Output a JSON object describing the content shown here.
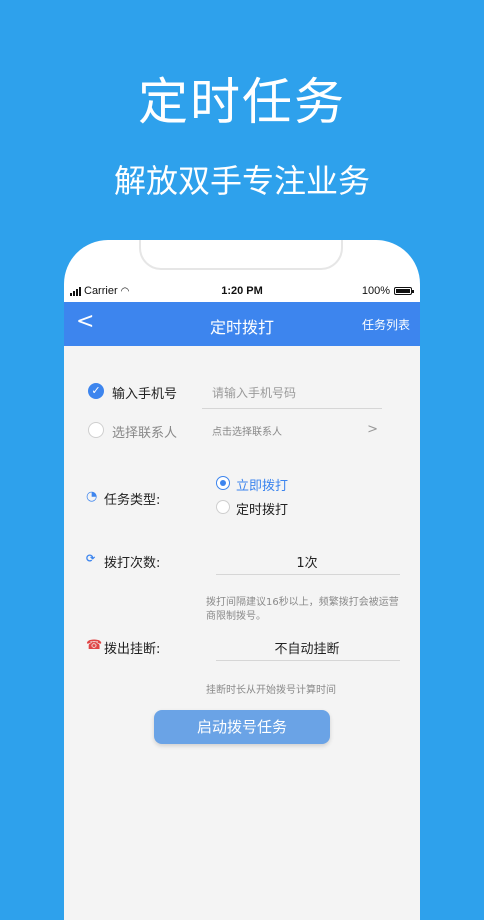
{
  "hero": {
    "title": "定时任务",
    "subtitle": "解放双手专注业务"
  },
  "status_bar": {
    "carrier": "Carrier",
    "time": "1:20 PM",
    "battery": "100%"
  },
  "nav": {
    "back": "<",
    "title": "定时拨打",
    "right": "任务列表"
  },
  "form": {
    "phone_option_label": "输入手机号",
    "phone_placeholder": "请输入手机号码",
    "contact_option_label": "选择联系人",
    "contact_placeholder": "点击选择联系人",
    "contact_chevron": ">",
    "task_type_label": "任务类型:",
    "task_type_options": [
      "立即拨打",
      "定时拨打"
    ],
    "task_type_selected": "立即拨打",
    "dial_count_label": "拨打次数:",
    "dial_count_value": "1次",
    "dial_hint": "拨打间隔建议16秒以上，频繁拨打会被运营商限制拨号。",
    "hangup_label": "拨出挂断:",
    "hangup_value": "不自动挂断",
    "hangup_hint": "挂断时长从开始拨号计算时间",
    "start_button": "启动拨号任务"
  },
  "colors": {
    "background": "#2ea1ec",
    "nav": "#3d85ee",
    "button": "#6aa3e6",
    "hangup_icon": "#e04545"
  },
  "icons": {
    "task_type": "clock-icon",
    "dial_count": "repeat-counter-icon",
    "hangup": "phone-hangup-icon"
  }
}
